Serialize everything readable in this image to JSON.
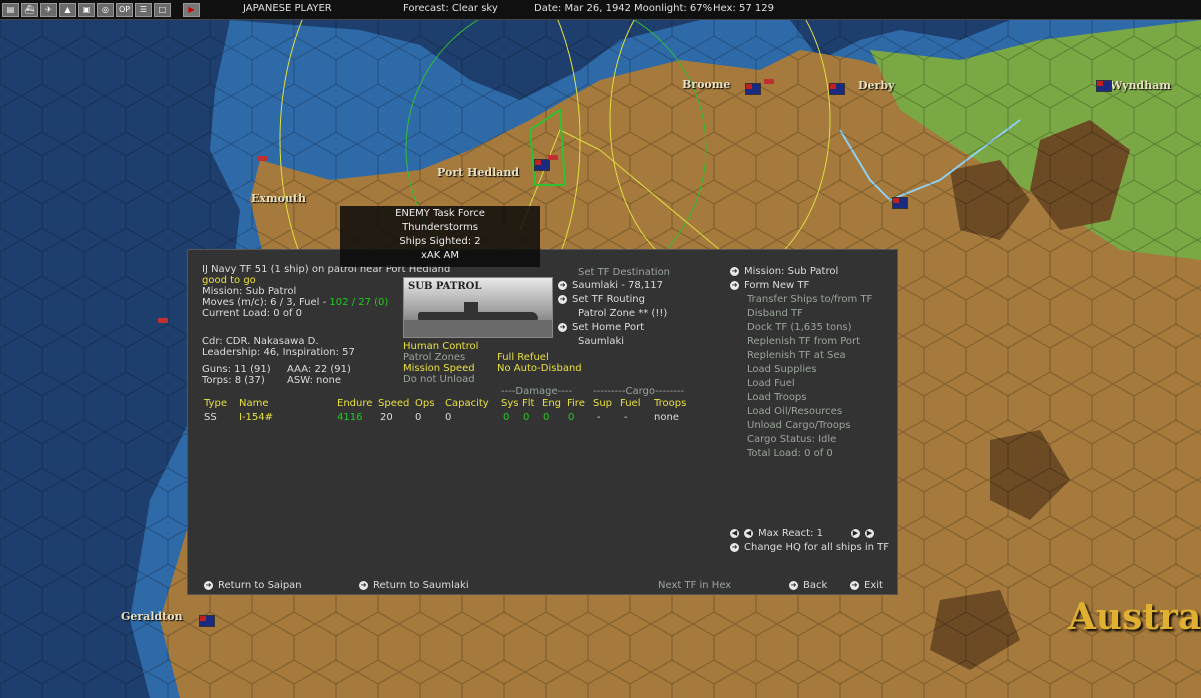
{
  "topbar": {
    "player": "JAPANESE PLAYER",
    "forecast": "Forecast: Clear sky",
    "date": "Date: Mar 26, 1942",
    "moonlight": "Moonlight: 67%",
    "hex": "Hex: 57 129",
    "buttons": [
      "map-icon",
      "ship-icon",
      "air-icon",
      "land-icon",
      "disk-icon",
      "globe-icon",
      "op-icon",
      "list-icon",
      "window-icon",
      "play-icon"
    ],
    "btn_op": "OP"
  },
  "map": {
    "cities": [
      "Broome",
      "Derby",
      "Wyndham",
      "Port Hedland",
      "Exmouth",
      "Geraldton"
    ],
    "region_label": "Austral",
    "colors": {
      "sea": "#1e3f6e",
      "coast_sea": "#2f6aa8",
      "land": "#a57a3c",
      "green_land": "#7aa844",
      "river": "#8fd0f0"
    }
  },
  "tooltip": {
    "line1": "ENEMY Task Force",
    "line2": "Thunderstorms",
    "line3": "Ships Sighted: 2",
    "line4": "xAK AM"
  },
  "panel": {
    "tf_line": "IJ Navy TF 51 (1 ship)  on patrol near Port Hedland",
    "status": "good to go",
    "mission": "Mission: Sub Patrol",
    "moves_prefix": "Moves (m/c): 6 / 3, Fuel - ",
    "fuel": "102 / 27 (0)",
    "load": "Current Load: 0 of 0",
    "cdr": "Cdr: CDR. Nakasawa D.",
    "leadership": "Leadership: 46, Inspiration: 57",
    "guns": "Guns: 11 (91)",
    "aaa": "AAA: 22 (91)",
    "torps": "Torps: 8 (37)",
    "asw": "ASW: none",
    "image_label": "SUB PATROL",
    "human_control": "Human Control",
    "patrol_zones": "Patrol Zones",
    "mission_speed": "Mission Speed",
    "do_not_unload": "Do not Unload",
    "full_refuel": "Full Refuel",
    "no_auto_disband": "No Auto-Disband",
    "set_tf_destination": "Set TF Destination",
    "destination": "Saumlaki - 78,117",
    "set_tf_routing": "Set TF Routing",
    "patrol_zone": "Patrol Zone ** (!!)",
    "set_home_port": "Set Home Port",
    "home_port": "Saumlaki",
    "damage_header": "----Damage----",
    "cargo_header": "---------Cargo--------",
    "columns": [
      "Type",
      "Name",
      "Endure",
      "Speed",
      "Ops",
      "Capacity",
      "Sys",
      "Flt",
      "Eng",
      "Fire",
      "Sup",
      "Fuel",
      "Troops"
    ],
    "rows": [
      {
        "type": "SS",
        "name": "I-154#",
        "endure": "4116",
        "speed": "20",
        "ops": "0",
        "capacity": "0",
        "sys": "0",
        "flt": "0",
        "eng": "0",
        "fire": "0",
        "sup": "-",
        "fuel": "-",
        "troops": "none"
      }
    ],
    "right_menu": [
      "Mission: Sub Patrol",
      "Form New TF",
      "Transfer Ships to/from TF",
      "Disband TF",
      "Dock TF (1,635 tons)",
      "Replenish TF from Port",
      "Replenish TF at Sea",
      "Load Supplies",
      "Load Fuel",
      "Load Troops",
      "Load Oil/Resources",
      "Unload Cargo/Troops",
      "Cargo Status: Idle",
      "Total Load: 0 of 0"
    ],
    "max_react": "Max React:  1",
    "change_hq": "Change HQ for all ships in TF",
    "return_saipan": "Return to Saipan",
    "return_saumlaki": "Return to Saumlaki",
    "next_tf": "Next TF in Hex",
    "back": "Back",
    "exit": "Exit"
  }
}
